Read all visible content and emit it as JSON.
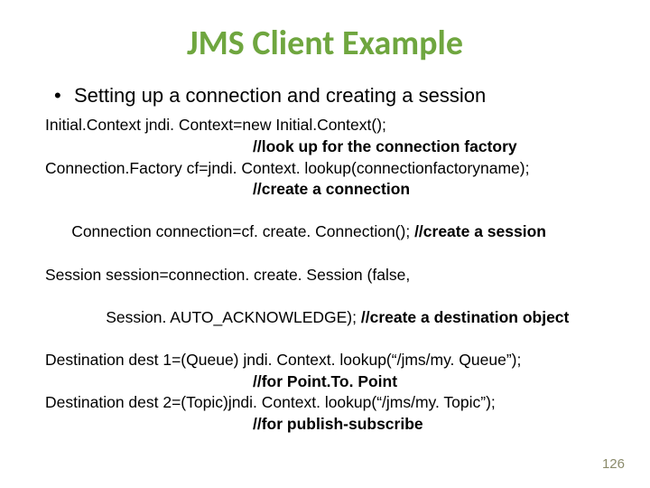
{
  "title": "JMS Client Example",
  "bullet": "Setting up a connection and creating a session",
  "code": {
    "l1": "Initial.Context jndi. Context=new Initial.Context();",
    "l2": "//look up for the connection factory",
    "l3": "Connection.Factory cf=jndi. Context. lookup(connectionfactoryname);",
    "l4": "//create a connection",
    "l5a": "Connection connection=cf. create. Connection(); ",
    "l5b": "//create a session",
    "l6": "Session session=connection. create. Session (false,",
    "l7a": "Session. AUTO_ACKNOWLEDGE); ",
    "l7b": "//create a destination object",
    "l8": "Destination dest 1=(Queue) jndi. Context. lookup(“/jms/my. Queue”);",
    "l9": "//for Point.To. Point",
    "l10": "Destination dest 2=(Topic)jndi. Context. lookup(“/jms/my. Topic”);",
    "l11": "//for publish-subscribe"
  },
  "pagenum": "126"
}
